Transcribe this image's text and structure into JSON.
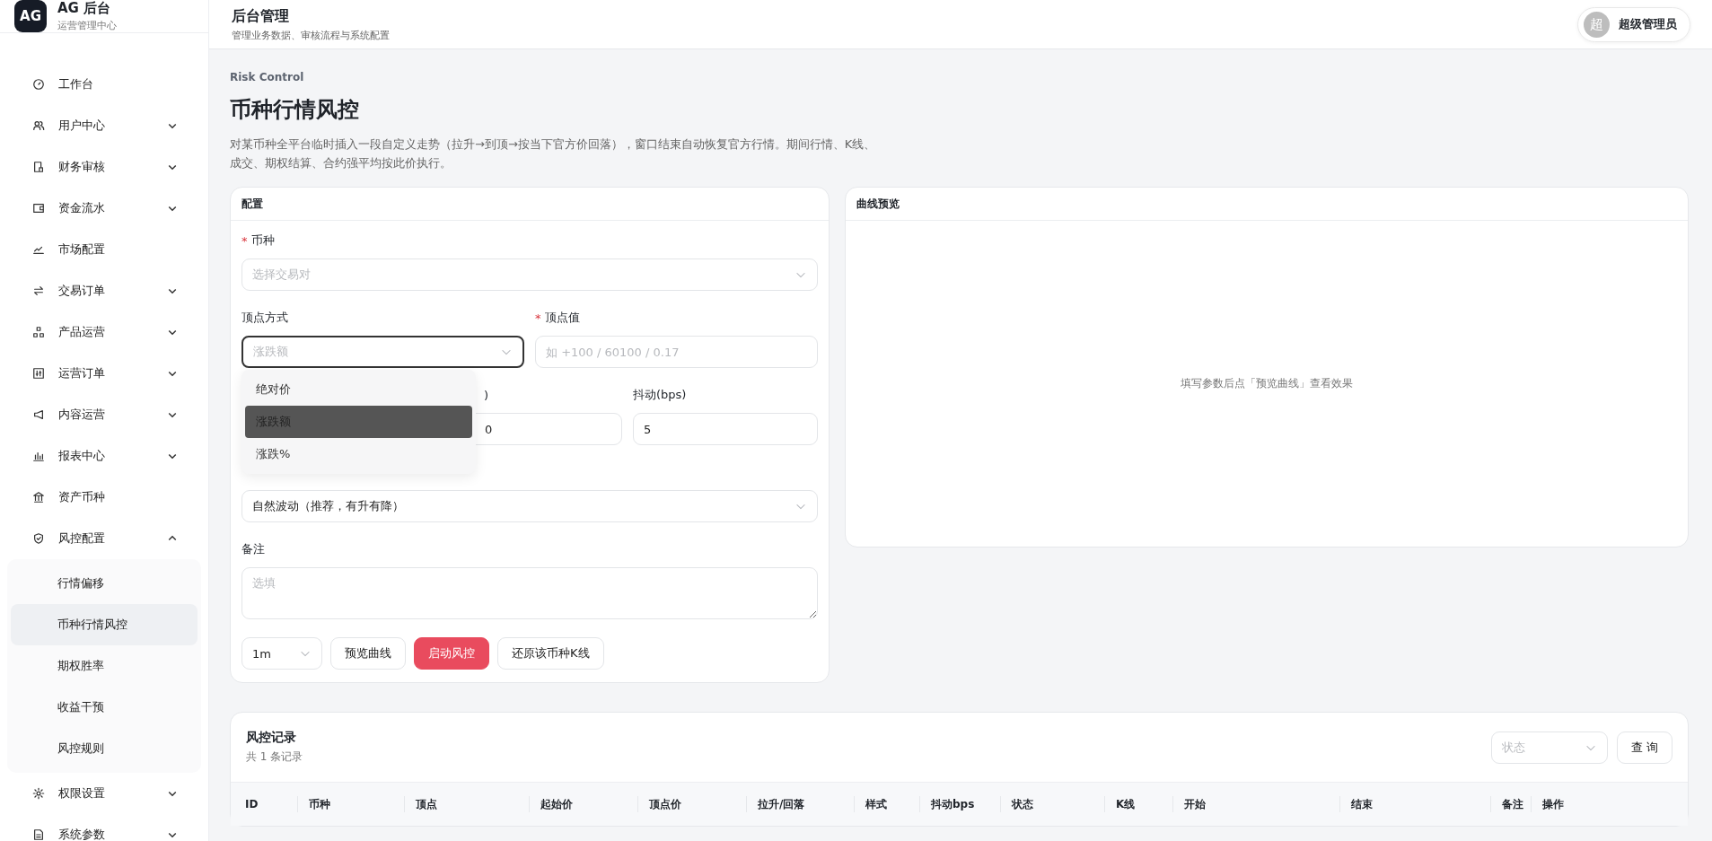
{
  "brand": {
    "logo": "AG",
    "title": "AG 后台",
    "subtitle": "运营管理中心"
  },
  "header": {
    "title": "后台管理",
    "subtitle": "管理业务数据、审核流程与系统配置",
    "user": {
      "avatar": "超",
      "name": "超级管理员"
    }
  },
  "sidebar": {
    "items": [
      {
        "label": "工作台",
        "kind": "link"
      },
      {
        "label": "用户中心",
        "kind": "group",
        "expanded": false
      },
      {
        "label": "财务审核",
        "kind": "group",
        "expanded": false
      },
      {
        "label": "资金流水",
        "kind": "group",
        "expanded": false
      },
      {
        "label": "市场配置",
        "kind": "link"
      },
      {
        "label": "交易订单",
        "kind": "group",
        "expanded": false
      },
      {
        "label": "产品运营",
        "kind": "group",
        "expanded": false
      },
      {
        "label": "运营订单",
        "kind": "group",
        "expanded": false
      },
      {
        "label": "内容运营",
        "kind": "group",
        "expanded": false
      },
      {
        "label": "报表中心",
        "kind": "group",
        "expanded": false
      },
      {
        "label": "资产币种",
        "kind": "link"
      },
      {
        "label": "风控配置",
        "kind": "group",
        "expanded": true,
        "children": [
          {
            "label": "行情偏移",
            "selected": false
          },
          {
            "label": "币种行情风控",
            "selected": true
          },
          {
            "label": "期权胜率",
            "selected": false
          },
          {
            "label": "收益干预",
            "selected": false
          },
          {
            "label": "风控规则",
            "selected": false
          }
        ]
      },
      {
        "label": "权限设置",
        "kind": "group",
        "expanded": false
      },
      {
        "label": "系统参数",
        "kind": "group",
        "expanded": false
      }
    ]
  },
  "page": {
    "eyebrow": "Risk Control",
    "title": "币种行情风控",
    "description": "对某币种全平台临时插入一段自定义走势（拉升→到顶→按当下官方价回落），窗口结束自动恢复官方行情。期间行情、K线、成交、期权结算、合约强平均按此价执行。"
  },
  "config": {
    "title": "配置",
    "fields": [
      {
        "kind": "select",
        "required_mark": "*",
        "label": "币种",
        "placeholder": "选择交易对"
      },
      {
        "kind": "select",
        "label": "顶点方式",
        "placeholder": "涨跌额",
        "focused": true,
        "options": [
          {
            "label": "绝对价",
            "selected": false
          },
          {
            "label": "涨跌额",
            "selected": true
          },
          {
            "label": "涨跌%",
            "selected": false
          }
        ]
      },
      {
        "kind": "input",
        "required_mark": "*",
        "label": "顶点值",
        "placeholder": "如 +100 / 60100 / 0.17"
      },
      {
        "kind": "input",
        "label": ")",
        "value": "0"
      },
      {
        "kind": "input",
        "label": "抖动(bps)",
        "value": "5"
      },
      {
        "kind": "select",
        "value": "自然波动（推荐，有升有降）"
      },
      {
        "kind": "textarea",
        "label": "备注",
        "placeholder": "选填"
      }
    ],
    "interval": "1m",
    "buttons": [
      {
        "label": "预览曲线",
        "kind": "default"
      },
      {
        "label": "启动风控",
        "kind": "danger"
      },
      {
        "label": "还原该币种K线",
        "kind": "default"
      }
    ]
  },
  "preview": {
    "title": "曲线预览",
    "hint": "填写参数后点「预览曲线」查看效果"
  },
  "records": {
    "title": "风控记录",
    "count": "共 1 条记录",
    "status_placeholder": "状态",
    "query_button": "查 询",
    "columns": [
      "ID",
      "币种",
      "顶点",
      "起始价",
      "顶点价",
      "拉升/回落",
      "样式",
      "抖动bps",
      "状态",
      "K线",
      "开始",
      "结束",
      "备注",
      "操作"
    ]
  }
}
